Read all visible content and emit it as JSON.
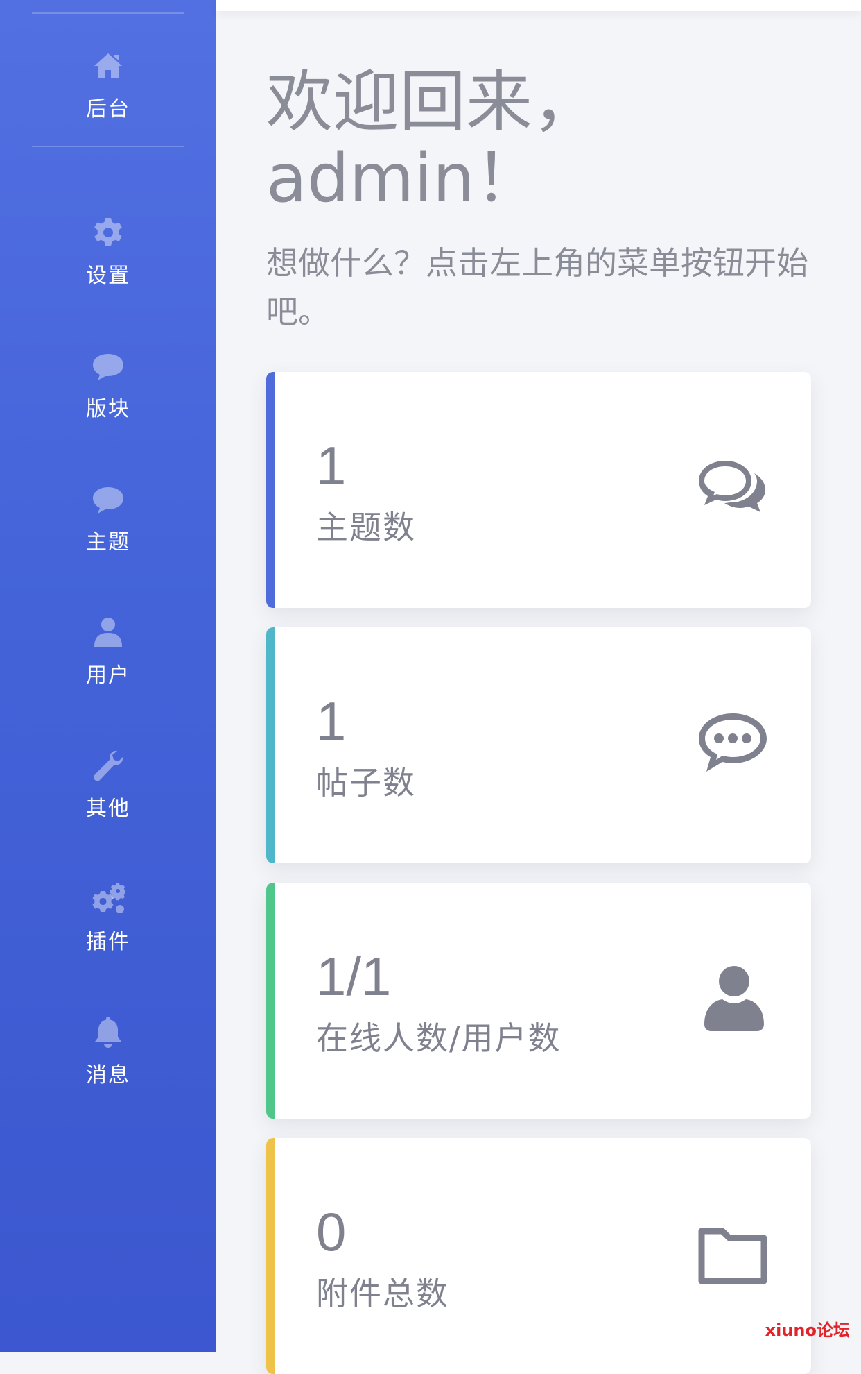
{
  "sidebar": {
    "items": [
      {
        "label": "后台",
        "icon": "home-icon"
      },
      {
        "label": "设置",
        "icon": "gear-icon"
      },
      {
        "label": "版块",
        "icon": "chat-bubble-icon"
      },
      {
        "label": "主题",
        "icon": "chat-bubble-icon"
      },
      {
        "label": "用户",
        "icon": "user-icon"
      },
      {
        "label": "其他",
        "icon": "wrench-icon"
      },
      {
        "label": "插件",
        "icon": "gears-icon"
      },
      {
        "label": "消息",
        "icon": "bell-icon"
      }
    ]
  },
  "main": {
    "welcome_line1": "欢迎回来，",
    "welcome_line2": "admin！",
    "subtitle": "想做什么？点击左上角的菜单按钮开始吧。",
    "stats": [
      {
        "value": "1",
        "caption": "主题数",
        "icon": "comments-icon",
        "accent": "#4f6bdc"
      },
      {
        "value": "1",
        "caption": "帖子数",
        "icon": "comment-dots-icon",
        "accent": "#4fb7c9"
      },
      {
        "value": "1/1",
        "caption": "在线人数/用户数",
        "icon": "user-icon",
        "accent": "#4fc68a"
      },
      {
        "value": "0",
        "caption": "附件总数",
        "icon": "folder-icon",
        "accent": "#efc24a"
      }
    ]
  },
  "watermark": "xiuno论坛",
  "colors": {
    "sidebar": "#4a66db",
    "text_muted": "#8a8d98",
    "card_icon": "#7f828e"
  }
}
